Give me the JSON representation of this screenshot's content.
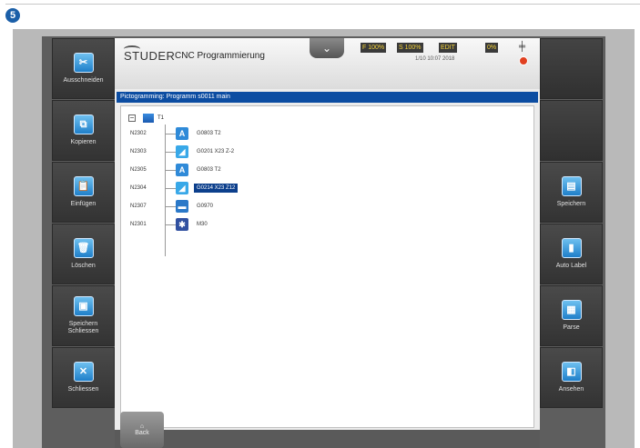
{
  "step": "5",
  "left_sidebar": [
    {
      "label": "Ausschneiden",
      "icon": "scissors-icon",
      "glyph": "✂"
    },
    {
      "label": "Kopieren",
      "icon": "copy-icon",
      "glyph": "⧉"
    },
    {
      "label": "Einfügen",
      "icon": "paste-icon",
      "glyph": "📋"
    },
    {
      "label": "Löschen",
      "icon": "trash-icon",
      "glyph": "🗑"
    },
    {
      "label": "Speichern Schliessen",
      "icon": "save-close-icon",
      "glyph": "▣"
    },
    {
      "label": "Schliessen",
      "icon": "close-icon",
      "glyph": "✕"
    }
  ],
  "right_sidebar": [
    {
      "label": "",
      "icon": "",
      "glyph": ""
    },
    {
      "label": "",
      "icon": "",
      "glyph": ""
    },
    {
      "label": "Speichern",
      "icon": "save-icon",
      "glyph": "▤"
    },
    {
      "label": "Auto Label",
      "icon": "document-icon",
      "glyph": "▮"
    },
    {
      "label": "Parse",
      "icon": "parse-icon",
      "glyph": "▦"
    },
    {
      "label": "Ansehen",
      "icon": "view-icon",
      "glyph": "◧"
    }
  ],
  "header": {
    "logo": "STUDER",
    "title": "CNC Programmierung",
    "status": [
      "F 100%",
      "S 100%",
      "EDIT",
      "0%"
    ],
    "datetime": "1/10 10:07 2018",
    "accent": "#0c4da2"
  },
  "title_bar": "Pictogramming: Programm s0011 main",
  "tree": {
    "root_label": "T1",
    "rows": [
      {
        "num": "N2302",
        "label": "G0803 T2",
        "icon": "cone-icon",
        "glyph": "A",
        "color": "#2f8ad8",
        "selected": false
      },
      {
        "num": "N2303",
        "label": "G0201 X23 Z-2",
        "icon": "grind-icon",
        "glyph": "◢",
        "color": "#38a8e8",
        "selected": false
      },
      {
        "num": "N2305",
        "label": "G0803 T2",
        "icon": "cone-icon",
        "glyph": "A",
        "color": "#2f8ad8",
        "selected": false
      },
      {
        "num": "N2304",
        "label": "G0214 X23 Z12",
        "icon": "grind-icon",
        "glyph": "◢",
        "color": "#38a8e8",
        "selected": true
      },
      {
        "num": "N2307",
        "label": "G0970",
        "icon": "dress-icon",
        "glyph": "▬",
        "color": "#2a78c8",
        "selected": false
      },
      {
        "num": "N2301",
        "label": "M30",
        "icon": "end-icon",
        "glyph": "✱",
        "color": "#3050a0",
        "selected": false
      }
    ]
  },
  "back_label": "Back"
}
